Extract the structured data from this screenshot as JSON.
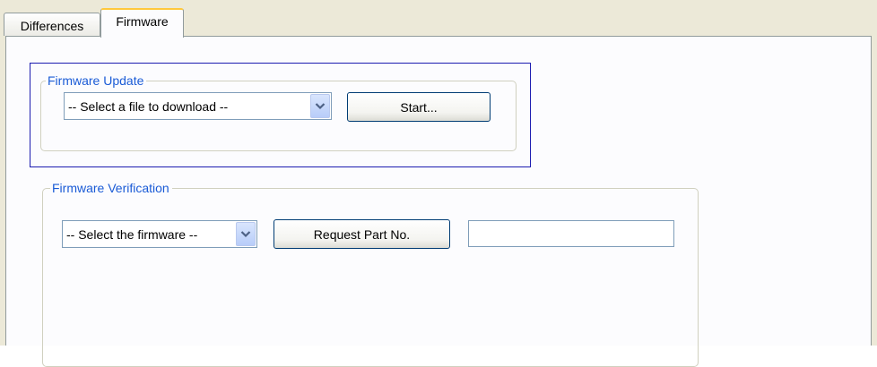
{
  "tabs": [
    {
      "label": "Differences",
      "active": false
    },
    {
      "label": "Firmware",
      "active": true
    }
  ],
  "firmware_update": {
    "legend": "Firmware Update",
    "file_select": {
      "selected": "-- Select a file to download --"
    },
    "start_label": "Start..."
  },
  "firmware_verification": {
    "legend": "Firmware Verification",
    "firmware_select": {
      "selected": "-- Select the firmware --"
    },
    "request_label": "Request Part No.",
    "part_no_value": ""
  },
  "colors": {
    "legend_text": "#1a5bd6",
    "focus_border": "#1c1cb0",
    "button_border": "#003c74",
    "active_tab_highlight": "#ffc83c"
  },
  "icons": {
    "dropdown_arrow": "chevron-down-icon"
  }
}
